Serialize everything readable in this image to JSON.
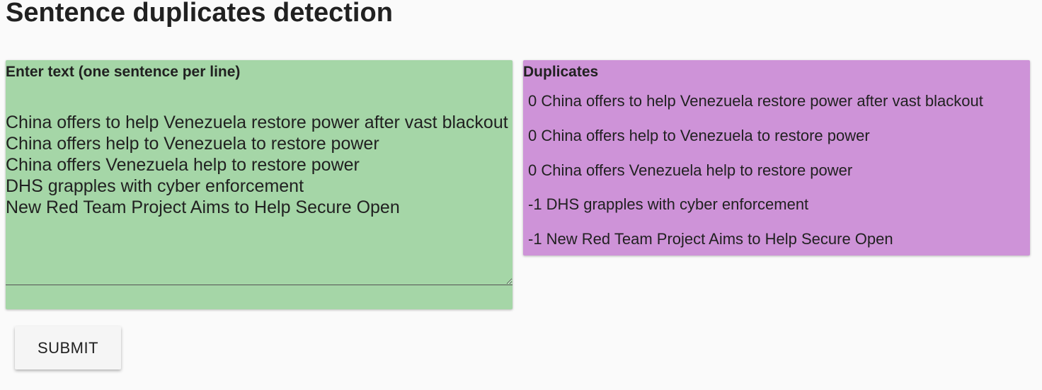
{
  "page": {
    "title": "Sentence duplicates detection"
  },
  "input_panel": {
    "label": "Enter text (one sentence per line)",
    "value": "China offers to help Venezuela restore power after vast blackout\nChina offers help to Venezuela to restore power\nChina offers Venezuela help to restore power\nDHS grapples with cyber enforcement\nNew Red Team Project Aims to Help Secure Open",
    "background_color": "#a5d6a7"
  },
  "output_panel": {
    "label": "Duplicates",
    "background_color": "#ce93d8",
    "items": [
      "0 China offers to help Venezuela restore power after vast blackout",
      "0 China offers help to Venezuela to restore power",
      "0 China offers Venezuela help to restore power",
      "-1 DHS grapples with cyber enforcement",
      "-1 New Red Team Project Aims to Help Secure Open"
    ]
  },
  "actions": {
    "submit_label": "SUBMIT"
  }
}
